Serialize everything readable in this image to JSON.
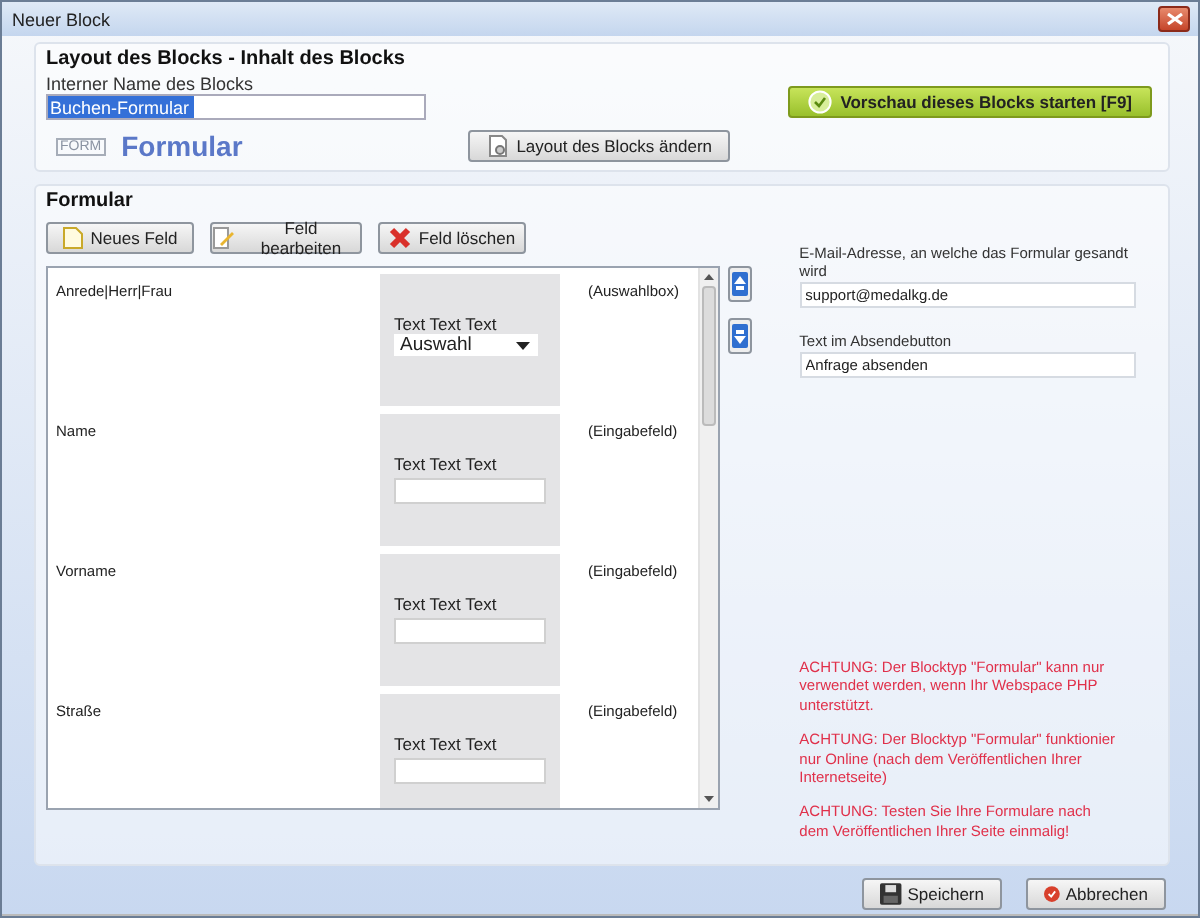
{
  "window": {
    "title": "Neuer Block"
  },
  "block_group": {
    "title": "Layout des Blocks - Inhalt des Blocks",
    "name_label": "Interner Name des Blocks",
    "name_value": "Buchen-Formular",
    "type_tag": "FORM",
    "type_name": "Formular",
    "layout_button": "Layout des Blocks ändern",
    "preview_button": "Vorschau dieses Blocks starten [F9]"
  },
  "form_group": {
    "title": "Formular",
    "buttons": [
      {
        "kind": "new",
        "label": "Neues Feld"
      },
      {
        "kind": "edit",
        "label": "Feld bearbeiten"
      },
      {
        "kind": "delete",
        "label": "Feld löschen"
      }
    ],
    "fields": [
      {
        "name": "Anrede|Herr|Frau",
        "kind": "select",
        "preview_label": "Text Text Text",
        "preview_value": "Auswahl",
        "type": "(Auswahlbox)"
      },
      {
        "name": "Name",
        "kind": "input",
        "preview_label": "Text Text Text",
        "type": "(Eingabefeld)"
      },
      {
        "name": "Vorname",
        "kind": "input",
        "preview_label": "Text Text Text",
        "type": "(Eingabefeld)"
      },
      {
        "name": "Straße",
        "kind": "input",
        "preview_label": "Text Text Text",
        "type": "(Eingabefeld)"
      }
    ],
    "email_label": "E-Mail-Adresse, an welche das Formular gesandt wird",
    "email_value": "support@medalkg.de",
    "submit_label": "Text im Absendebutton",
    "submit_value": "Anfrage absenden",
    "warnings": [
      "ACHTUNG: Der Blocktyp \"Formular\" kann nur verwendet werden, wenn Ihr Webspace PHP unterstützt.",
      "ACHTUNG: Der Blocktyp \"Formular\" funktionier nur Online (nach dem Veröffentlichen Ihrer Internetseite)",
      "ACHTUNG: Testen Sie Ihre Formulare nach dem Veröffentlichen Ihrer Seite einmalig!"
    ]
  },
  "footer": {
    "save": "Speichern",
    "cancel": "Abbrechen"
  }
}
